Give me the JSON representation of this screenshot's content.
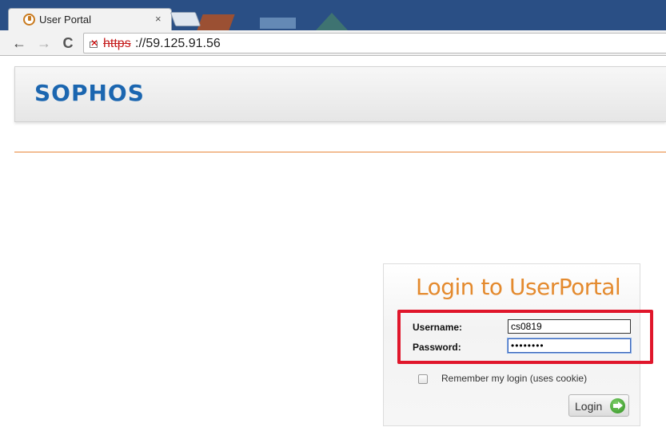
{
  "browser": {
    "tab": {
      "title": "User Portal",
      "close_glyph": "×"
    },
    "nav": {
      "back": "←",
      "forward": "→",
      "reload": "C"
    },
    "address": {
      "scheme": "https",
      "rest": "://59.125.91.56"
    }
  },
  "header": {
    "logo": "SOPHOS"
  },
  "login": {
    "title": "Login to UserPortal",
    "username_label": "Username:",
    "username_value": "cs0819",
    "password_label": "Password:",
    "password_value": "••••••••",
    "remember_label": "Remember my login (uses cookie)",
    "remember_checked": false,
    "submit_label": "Login"
  },
  "colors": {
    "brand_blue": "#1b66b0",
    "accent_orange": "#e48a2e",
    "highlight_red": "#e0162b",
    "go_green": "#2e8f1f"
  },
  "icons": {
    "favicon": "sophos-favicon-icon",
    "insecure": "insecure-lock-icon",
    "submit": "arrow-right-icon"
  }
}
